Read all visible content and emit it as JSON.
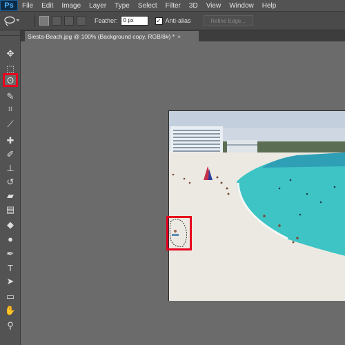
{
  "app": {
    "logo": "Ps"
  },
  "menu": [
    "File",
    "Edit",
    "Image",
    "Layer",
    "Type",
    "Select",
    "Filter",
    "3D",
    "View",
    "Window",
    "Help"
  ],
  "options": {
    "tool_icon": "lasso-icon",
    "feather_label": "Feather:",
    "feather_value": "0 px",
    "anti_alias_label": "Anti-alias",
    "anti_alias_checked": true,
    "refine_edge_label": "Refine Edge..."
  },
  "document": {
    "tab_title": "Siesta-Beach.jpg @ 100% (Background copy, RGB/8#) *",
    "close_glyph": "×"
  },
  "toolbar": {
    "tools": [
      {
        "name": "move-tool",
        "glyph": "✥"
      },
      {
        "name": "marquee-tool",
        "glyph": "⬚"
      },
      {
        "name": "lasso-tool",
        "glyph": "ʘ",
        "selected": true
      },
      {
        "name": "quick-selection-tool",
        "glyph": "✎"
      },
      {
        "name": "crop-tool",
        "glyph": "⌗"
      },
      {
        "name": "eyedropper-tool",
        "glyph": "⟋"
      },
      {
        "name": "healing-brush-tool",
        "glyph": "✚"
      },
      {
        "name": "brush-tool",
        "glyph": "✐"
      },
      {
        "name": "clone-stamp-tool",
        "glyph": "⊥"
      },
      {
        "name": "history-brush-tool",
        "glyph": "↺"
      },
      {
        "name": "eraser-tool",
        "glyph": "▰"
      },
      {
        "name": "gradient-tool",
        "glyph": "▤"
      },
      {
        "name": "blur-tool",
        "glyph": "◆"
      },
      {
        "name": "dodge-tool",
        "glyph": "●"
      },
      {
        "name": "pen-tool",
        "glyph": "✒"
      },
      {
        "name": "type-tool",
        "glyph": "T"
      },
      {
        "name": "path-selection-tool",
        "glyph": "➤"
      },
      {
        "name": "shape-tool",
        "glyph": "▭"
      },
      {
        "name": "hand-tool",
        "glyph": "✋"
      },
      {
        "name": "zoom-tool",
        "glyph": "⚲"
      }
    ]
  },
  "colors": {
    "highlight": "#e8001d",
    "sea": "#3ec4c4",
    "sand": "#ece9e2"
  }
}
